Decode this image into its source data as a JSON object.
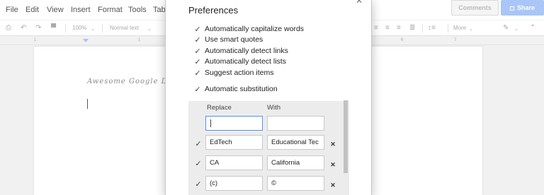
{
  "menubar": {
    "items": [
      "File",
      "Edit",
      "View",
      "Insert",
      "Format",
      "Tools",
      "Tab"
    ],
    "comments_label": "Comments",
    "share_label": "Share"
  },
  "toolbar": {
    "zoom": "100%",
    "style": "Normal text",
    "more_label": "More",
    "icons": [
      "print-icon",
      "undo-icon",
      "redo-icon",
      "paint-format-icon",
      "align-left-icon",
      "align-center-icon",
      "align-right-icon",
      "align-justify-icon",
      "line-spacing-icon",
      "pencil-icon",
      "collapse-icon"
    ]
  },
  "ruler": {
    "numbers": [
      "1",
      "1",
      "6",
      "7"
    ]
  },
  "document": {
    "title": "Awesome Google D"
  },
  "dialog": {
    "title": "Preferences",
    "options": [
      {
        "label": "Automatically capitalize words",
        "checked": true
      },
      {
        "label": "Use smart quotes",
        "checked": true
      },
      {
        "label": "Automatically detect links",
        "checked": true
      },
      {
        "label": "Automatically detect lists",
        "checked": true
      },
      {
        "label": "Suggest action items",
        "checked": true
      }
    ],
    "substitution": {
      "label": "Automatic substitution",
      "checked": true
    },
    "table": {
      "replace_header": "Replace",
      "with_header": "With",
      "new_row": {
        "replace": "",
        "with": ""
      },
      "rows": [
        {
          "checked": true,
          "replace": "EdTech",
          "with": "Educational Tec"
        },
        {
          "checked": true,
          "replace": "CA",
          "with": "California"
        },
        {
          "checked": true,
          "replace": "(c)",
          "with": "©"
        }
      ]
    }
  },
  "colors": {
    "share": "#a9c6f7",
    "focus": "#4d90fe"
  }
}
